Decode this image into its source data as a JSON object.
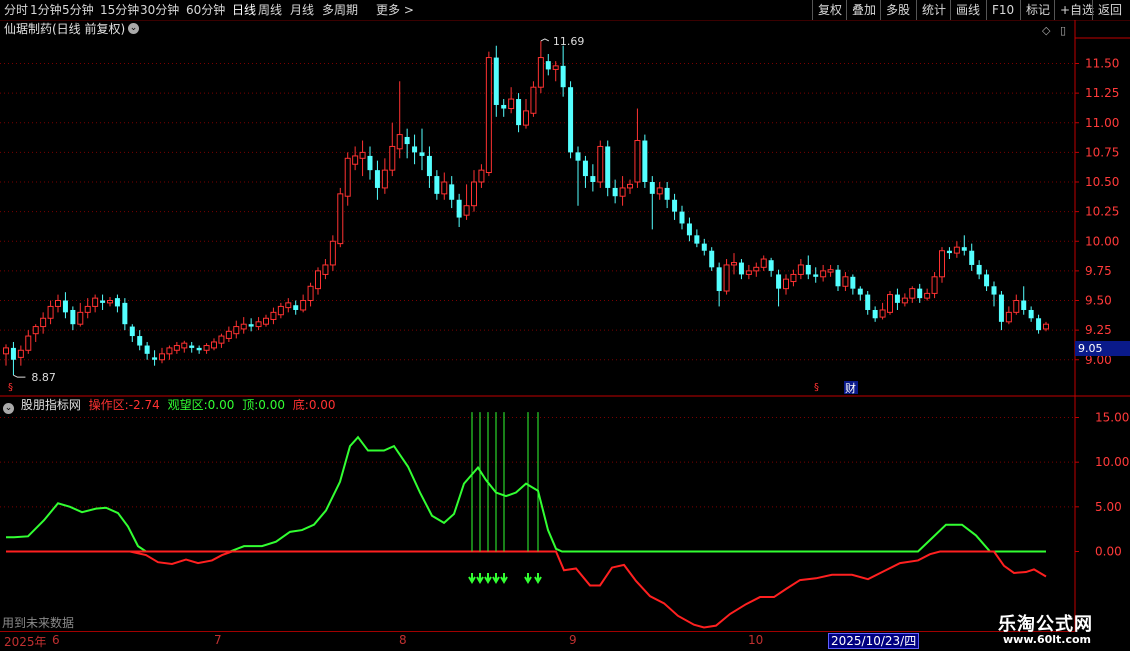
{
  "toolbar": {
    "left_items": [
      {
        "label": "分时"
      },
      {
        "label": "1分钟"
      },
      {
        "label": "5分钟"
      },
      {
        "label": "15分钟"
      },
      {
        "label": "30分钟"
      },
      {
        "label": "60分钟"
      },
      {
        "label": "日线"
      },
      {
        "label": "周线"
      },
      {
        "label": "月线"
      },
      {
        "label": "多周期"
      },
      {
        "label": "更多 >"
      }
    ],
    "right_items": [
      {
        "label": "复权"
      },
      {
        "label": "叠加"
      },
      {
        "label": "多股"
      },
      {
        "label": "统计"
      },
      {
        "label": "画线"
      },
      {
        "label": "F10"
      },
      {
        "label": "标记"
      },
      {
        "label": "+自选"
      },
      {
        "label": "返回"
      }
    ]
  },
  "main_chart": {
    "title": "仙琚制药(日线 前复权)",
    "y_ticks": [
      "11.50",
      "11.25",
      "11.00",
      "10.75",
      "10.50",
      "10.25",
      "10.00",
      "9.75",
      "9.50",
      "9.25",
      "9.00"
    ],
    "current_price": "9.05",
    "high_label": "11.69",
    "low_label": "8.87",
    "event_marks": [
      "财"
    ],
    "colors": {
      "up": "#ff3232",
      "down": "#54ffff",
      "grid": "#7a0000",
      "axis": "#ff2020"
    }
  },
  "sub_chart": {
    "name": "股朋指标网",
    "operate_label": "操作区:",
    "operate_value": "-2.74",
    "watch_label": "观望区:",
    "watch_value": "0.00",
    "top_label": "顶:",
    "top_value": "0.00",
    "bottom_label": "底:",
    "bottom_value": "0.00",
    "y_ticks": [
      "15.00",
      "10.00",
      "5.00",
      "0.00"
    ]
  },
  "footer": {
    "future_note": "用到未来数据",
    "year": "2025年",
    "months": [
      "6",
      "7",
      "8",
      "9",
      "10"
    ],
    "cursor_date": "2025/10/23/四"
  },
  "watermark": {
    "logo": "乐淘公式网",
    "url": "www.60lt.com"
  },
  "chart_data": {
    "type": "candlestick",
    "title": "仙琚制药(日线 前复权)",
    "ylim": [
      8.8,
      11.8
    ],
    "candles": [
      [
        9.05,
        9.1,
        8.95,
        9.13
      ],
      [
        9.1,
        9.0,
        8.87,
        9.15
      ],
      [
        9.02,
        9.08,
        8.95,
        9.12
      ],
      [
        9.08,
        9.2,
        9.05,
        9.25
      ],
      [
        9.22,
        9.28,
        9.15,
        9.3
      ],
      [
        9.28,
        9.35,
        9.22,
        9.4
      ],
      [
        9.35,
        9.45,
        9.3,
        9.5
      ],
      [
        9.45,
        9.5,
        9.4,
        9.55
      ],
      [
        9.5,
        9.4,
        9.35,
        9.57
      ],
      [
        9.42,
        9.3,
        9.25,
        9.45
      ],
      [
        9.3,
        9.4,
        9.28,
        9.48
      ],
      [
        9.4,
        9.45,
        9.35,
        9.52
      ],
      [
        9.45,
        9.52,
        9.4,
        9.55
      ],
      [
        9.5,
        9.48,
        9.42,
        9.55
      ],
      [
        9.48,
        9.5,
        9.45,
        9.53
      ],
      [
        9.52,
        9.45,
        9.4,
        9.55
      ],
      [
        9.48,
        9.3,
        9.25,
        9.52
      ],
      [
        9.28,
        9.2,
        9.15,
        9.3
      ],
      [
        9.2,
        9.12,
        9.08,
        9.25
      ],
      [
        9.12,
        9.05,
        9.0,
        9.15
      ],
      [
        9.02,
        9.0,
        8.95,
        9.08
      ],
      [
        9.0,
        9.05,
        8.97,
        9.1
      ],
      [
        9.05,
        9.1,
        9.0,
        9.12
      ],
      [
        9.08,
        9.12,
        9.05,
        9.15
      ],
      [
        9.1,
        9.14,
        9.06,
        9.16
      ],
      [
        9.12,
        9.1,
        9.06,
        9.15
      ],
      [
        9.1,
        9.08,
        9.05,
        9.12
      ],
      [
        9.08,
        9.12,
        9.05,
        9.14
      ],
      [
        9.1,
        9.15,
        9.08,
        9.18
      ],
      [
        9.14,
        9.2,
        9.1,
        9.22
      ],
      [
        9.18,
        9.24,
        9.15,
        9.28
      ],
      [
        9.22,
        9.28,
        9.18,
        9.33
      ],
      [
        9.26,
        9.3,
        9.22,
        9.36
      ],
      [
        9.3,
        9.28,
        9.24,
        9.35
      ],
      [
        9.28,
        9.32,
        9.25,
        9.36
      ],
      [
        9.3,
        9.35,
        9.28,
        9.38
      ],
      [
        9.34,
        9.4,
        9.3,
        9.44
      ],
      [
        9.38,
        9.45,
        9.35,
        9.48
      ],
      [
        9.44,
        9.48,
        9.4,
        9.52
      ],
      [
        9.46,
        9.42,
        9.38,
        9.5
      ],
      [
        9.42,
        9.5,
        9.4,
        9.55
      ],
      [
        9.5,
        9.62,
        9.45,
        9.65
      ],
      [
        9.6,
        9.75,
        9.55,
        9.78
      ],
      [
        9.72,
        9.8,
        9.68,
        9.85
      ],
      [
        9.8,
        10.0,
        9.75,
        10.05
      ],
      [
        9.98,
        10.4,
        9.95,
        10.45
      ],
      [
        10.38,
        10.7,
        10.3,
        10.75
      ],
      [
        10.65,
        10.72,
        10.6,
        10.8
      ],
      [
        10.7,
        10.75,
        10.55,
        10.85
      ],
      [
        10.72,
        10.6,
        10.52,
        10.8
      ],
      [
        10.6,
        10.45,
        10.35,
        10.68
      ],
      [
        10.45,
        10.6,
        10.4,
        10.7
      ],
      [
        10.6,
        10.8,
        10.55,
        11.0
      ],
      [
        10.78,
        10.9,
        10.7,
        11.35
      ],
      [
        10.88,
        10.82,
        10.7,
        10.95
      ],
      [
        10.8,
        10.75,
        10.65,
        10.9
      ],
      [
        10.75,
        10.72,
        10.6,
        10.95
      ],
      [
        10.72,
        10.55,
        10.45,
        10.8
      ],
      [
        10.55,
        10.4,
        10.35,
        10.6
      ],
      [
        10.4,
        10.5,
        10.35,
        10.58
      ],
      [
        10.48,
        10.35,
        10.28,
        10.55
      ],
      [
        10.35,
        10.2,
        10.12,
        10.4
      ],
      [
        10.22,
        10.3,
        10.18,
        10.48
      ],
      [
        10.3,
        10.5,
        10.25,
        10.6
      ],
      [
        10.5,
        10.6,
        10.45,
        10.65
      ],
      [
        10.58,
        11.55,
        10.55,
        11.6
      ],
      [
        11.55,
        11.15,
        11.05,
        11.65
      ],
      [
        11.15,
        11.12,
        11.05,
        11.2
      ],
      [
        11.12,
        11.2,
        11.08,
        11.3
      ],
      [
        11.2,
        10.98,
        10.92,
        11.25
      ],
      [
        10.98,
        11.1,
        10.95,
        11.2
      ],
      [
        11.08,
        11.3,
        11.05,
        11.35
      ],
      [
        11.3,
        11.55,
        11.25,
        11.69
      ],
      [
        11.52,
        11.45,
        11.4,
        11.58
      ],
      [
        11.45,
        11.48,
        11.35,
        11.52
      ],
      [
        11.48,
        11.3,
        11.22,
        11.65
      ],
      [
        11.3,
        10.75,
        10.7,
        11.35
      ],
      [
        10.75,
        10.68,
        10.3,
        10.8
      ],
      [
        10.68,
        10.55,
        10.45,
        10.72
      ],
      [
        10.55,
        10.5,
        10.42,
        10.65
      ],
      [
        10.5,
        10.8,
        10.45,
        10.85
      ],
      [
        10.8,
        10.45,
        10.38,
        10.85
      ],
      [
        10.45,
        10.38,
        10.32,
        10.52
      ],
      [
        10.38,
        10.45,
        10.3,
        10.55
      ],
      [
        10.45,
        10.48,
        10.4,
        10.52
      ],
      [
        10.5,
        10.85,
        10.45,
        11.12
      ],
      [
        10.85,
        10.5,
        10.45,
        10.9
      ],
      [
        10.5,
        10.4,
        10.1,
        10.55
      ],
      [
        10.4,
        10.45,
        10.35,
        10.5
      ],
      [
        10.45,
        10.35,
        10.28,
        10.5
      ],
      [
        10.35,
        10.25,
        10.18,
        10.4
      ],
      [
        10.25,
        10.15,
        10.1,
        10.3
      ],
      [
        10.15,
        10.05,
        10.0,
        10.2
      ],
      [
        10.05,
        9.98,
        9.95,
        10.1
      ],
      [
        9.98,
        9.92,
        9.88,
        10.02
      ],
      [
        9.92,
        9.78,
        9.75,
        9.95
      ],
      [
        9.78,
        9.58,
        9.45,
        9.82
      ],
      [
        9.58,
        9.8,
        9.55,
        9.85
      ],
      [
        9.8,
        9.82,
        9.72,
        9.9
      ],
      [
        9.82,
        9.72,
        9.68,
        9.85
      ],
      [
        9.72,
        9.75,
        9.68,
        9.8
      ],
      [
        9.75,
        9.78,
        9.7,
        9.82
      ],
      [
        9.78,
        9.85,
        9.75,
        9.88
      ],
      [
        9.84,
        9.75,
        9.7,
        9.86
      ],
      [
        9.72,
        9.6,
        9.45,
        9.76
      ],
      [
        9.6,
        9.68,
        9.55,
        9.72
      ],
      [
        9.66,
        9.72,
        9.62,
        9.76
      ],
      [
        9.72,
        9.8,
        9.68,
        9.85
      ],
      [
        9.8,
        9.72,
        9.68,
        9.88
      ],
      [
        9.72,
        9.7,
        9.65,
        9.78
      ],
      [
        9.7,
        9.75,
        9.66,
        9.8
      ],
      [
        9.74,
        9.76,
        9.7,
        9.8
      ],
      [
        9.76,
        9.62,
        9.58,
        9.8
      ],
      [
        9.62,
        9.7,
        9.58,
        9.74
      ],
      [
        9.7,
        9.6,
        9.55,
        9.72
      ],
      [
        9.6,
        9.55,
        9.5,
        9.62
      ],
      [
        9.55,
        9.42,
        9.38,
        9.58
      ],
      [
        9.42,
        9.35,
        9.32,
        9.45
      ],
      [
        9.36,
        9.42,
        9.34,
        9.48
      ],
      [
        9.4,
        9.55,
        9.38,
        9.58
      ],
      [
        9.55,
        9.48,
        9.42,
        9.6
      ],
      [
        9.48,
        9.52,
        9.45,
        9.56
      ],
      [
        9.52,
        9.6,
        9.48,
        9.62
      ],
      [
        9.6,
        9.52,
        9.48,
        9.64
      ],
      [
        9.52,
        9.56,
        9.5,
        9.6
      ],
      [
        9.56,
        9.7,
        9.52,
        9.74
      ],
      [
        9.7,
        9.92,
        9.65,
        9.95
      ],
      [
        9.92,
        9.9,
        9.85,
        9.95
      ],
      [
        9.9,
        9.95,
        9.86,
        10.0
      ],
      [
        9.95,
        9.92,
        9.88,
        10.05
      ],
      [
        9.92,
        9.8,
        9.75,
        9.98
      ],
      [
        9.8,
        9.72,
        9.68,
        9.84
      ],
      [
        9.72,
        9.62,
        9.58,
        9.76
      ],
      [
        9.62,
        9.55,
        9.45,
        9.66
      ],
      [
        9.55,
        9.32,
        9.25,
        9.58
      ],
      [
        9.32,
        9.4,
        9.3,
        9.45
      ],
      [
        9.4,
        9.5,
        9.38,
        9.55
      ],
      [
        9.5,
        9.42,
        9.38,
        9.62
      ],
      [
        9.42,
        9.35,
        9.32,
        9.45
      ],
      [
        9.35,
        9.25,
        9.22,
        9.38
      ],
      [
        9.26,
        9.3,
        9.24,
        9.32
      ]
    ]
  }
}
